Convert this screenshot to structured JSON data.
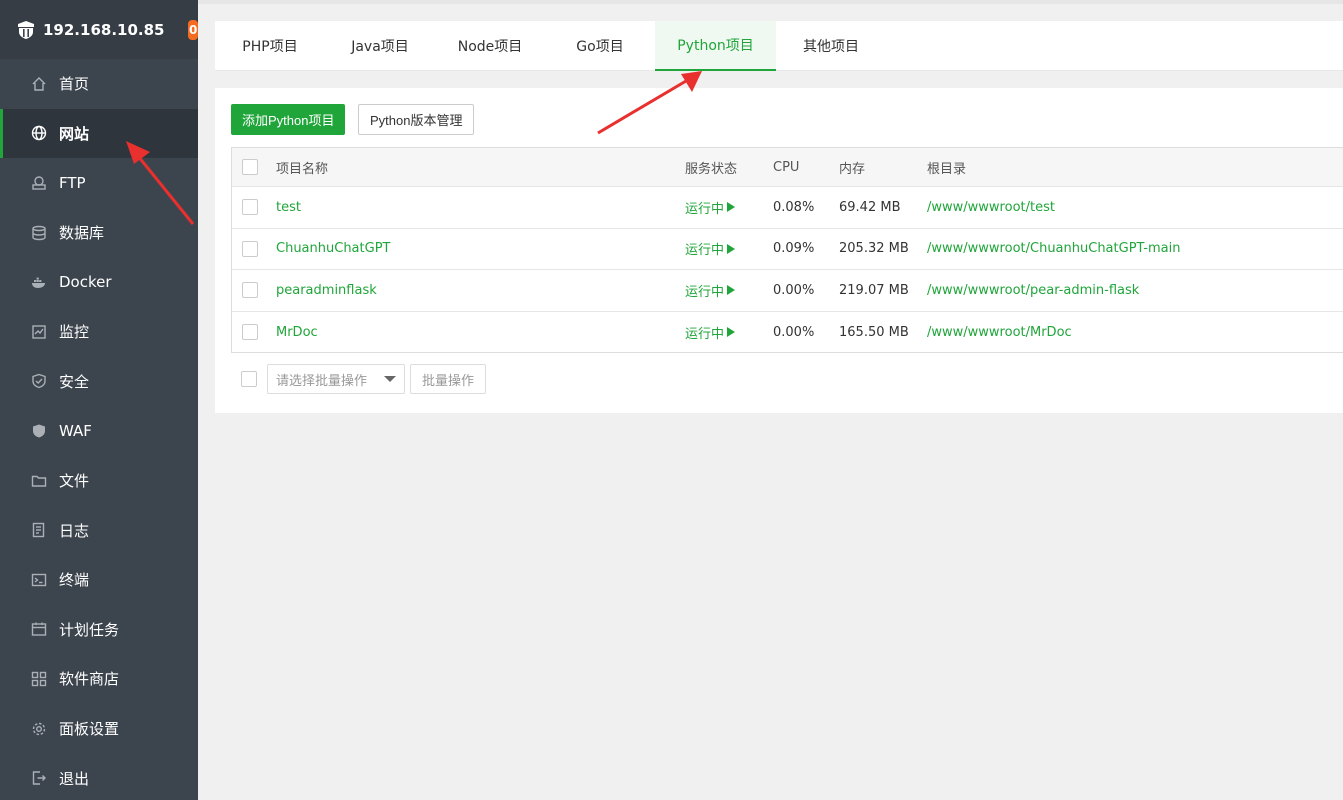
{
  "sidebar": {
    "server_ip": "192.168.10.85",
    "notification_count": "0",
    "items": [
      {
        "label": "首页",
        "icon": "home-icon"
      },
      {
        "label": "网站",
        "icon": "globe-icon"
      },
      {
        "label": "FTP",
        "icon": "ftp-icon"
      },
      {
        "label": "数据库",
        "icon": "database-icon"
      },
      {
        "label": "Docker",
        "icon": "docker-icon"
      },
      {
        "label": "监控",
        "icon": "monitor-icon"
      },
      {
        "label": "安全",
        "icon": "shield-check-icon"
      },
      {
        "label": "WAF",
        "icon": "waf-shield-icon"
      },
      {
        "label": "文件",
        "icon": "folder-icon"
      },
      {
        "label": "日志",
        "icon": "log-icon"
      },
      {
        "label": "终端",
        "icon": "terminal-icon"
      },
      {
        "label": "计划任务",
        "icon": "calendar-icon"
      },
      {
        "label": "软件商店",
        "icon": "apps-icon"
      },
      {
        "label": "面板设置",
        "icon": "gear-icon"
      },
      {
        "label": "退出",
        "icon": "logout-icon"
      }
    ],
    "active_index": 1
  },
  "tabs": [
    {
      "label": "PHP项目"
    },
    {
      "label": "Java项目"
    },
    {
      "label": "Node项目"
    },
    {
      "label": "Go项目"
    },
    {
      "label": "Python项目"
    },
    {
      "label": "其他项目"
    }
  ],
  "active_tab": 4,
  "toolbar": {
    "add_label": "添加Python项目",
    "version_label": "Python版本管理"
  },
  "table": {
    "headers": {
      "name": "项目名称",
      "status": "服务状态",
      "cpu": "CPU",
      "memory": "内存",
      "root": "根目录"
    },
    "rows": [
      {
        "name": "test",
        "status": "运行中",
        "cpu": "0.08%",
        "memory": "69.42 MB",
        "root": "/www/wwwroot/test"
      },
      {
        "name": "ChuanhuChatGPT",
        "status": "运行中",
        "cpu": "0.09%",
        "memory": "205.32 MB",
        "root": "/www/wwwroot/ChuanhuChatGPT-main"
      },
      {
        "name": "pearadminflask",
        "status": "运行中",
        "cpu": "0.00%",
        "memory": "219.07 MB",
        "root": "/www/wwwroot/pear-admin-flask"
      },
      {
        "name": "MrDoc",
        "status": "运行中",
        "cpu": "0.00%",
        "memory": "165.50 MB",
        "root": "/www/wwwroot/MrDoc"
      }
    ]
  },
  "batch": {
    "select_placeholder": "请选择批量操作",
    "button_label": "批量操作"
  },
  "colors": {
    "accent": "#20a53a",
    "sidebar_bg": "#3c444d",
    "badge": "#f56b20",
    "annotation": "#e8302e"
  }
}
